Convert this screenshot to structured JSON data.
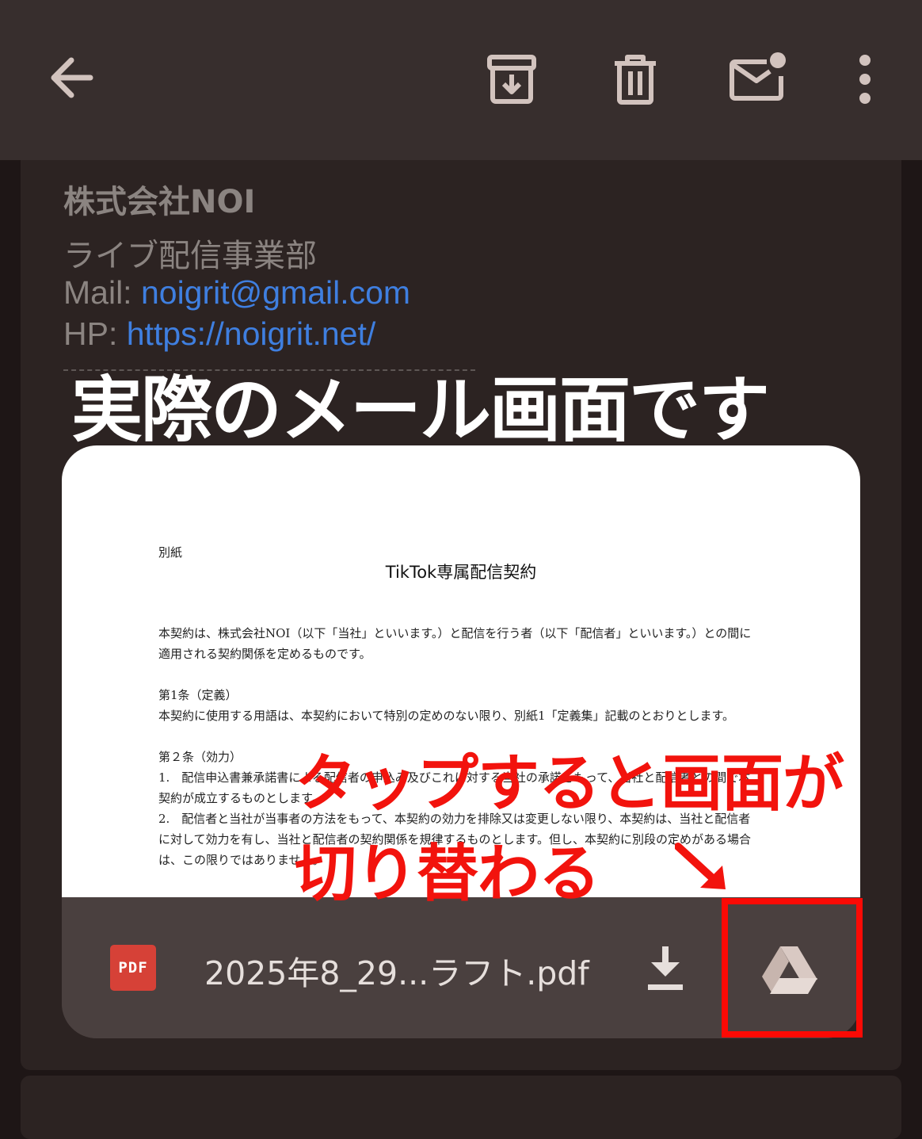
{
  "toolbar": {
    "back_icon": "arrow-back-icon",
    "archive_icon": "archive-icon",
    "delete_icon": "trash-icon",
    "unread_icon": "mark-unread-icon",
    "more_icon": "more-vert-icon"
  },
  "signature": {
    "company": "株式会社NOI",
    "department": "ライブ配信事業部",
    "mail_label": "Mail: ",
    "mail_value": "noigrit@gmail.com",
    "hp_label": "HP: ",
    "hp_value": "https://noigrit.net/"
  },
  "overlay_heading": "実際のメール画面です",
  "attachment": {
    "preview": {
      "label": "別紙",
      "title": "TikTok専属配信契約",
      "paragraphs": [
        "本契約は、株式会社NOI（以下「当社」といいます。）と配信を行う者（以下「配信者」といいます。）との間に適用される契約関係を定めるものです。",
        "第1条（定義）\n本契約に使用する用語は、本契約において特別の定めのない限り、別紙1「定義集」記載のとおりとします。",
        "第２条（効力）\n1.　配信申込書兼承諾書による配信者の申込み及びこれに対する当社の承諾をもって、当社と配信者との間で本契約が成立するものとします。\n2.　配信者と当社が当事者の方法をもって、本契約の効力を排除又は変更しない限り、本契約は、当社と配信者に対して効力を有し、当社と配信者の契約関係を規律するものとします。但し、本契約に別段の定めがある場合は、この限りではありません。"
      ]
    },
    "file_type_badge": "PDF",
    "file_name": "2025年8_29...ラフト.pdf",
    "download_icon": "download-icon",
    "drive_icon": "google-drive-icon"
  },
  "annotation": {
    "line1": "タップすると画面が",
    "line2": "切り替わる",
    "arrow_icon": "arrow-down-right-icon",
    "highlight_color": "#fa0a05"
  }
}
